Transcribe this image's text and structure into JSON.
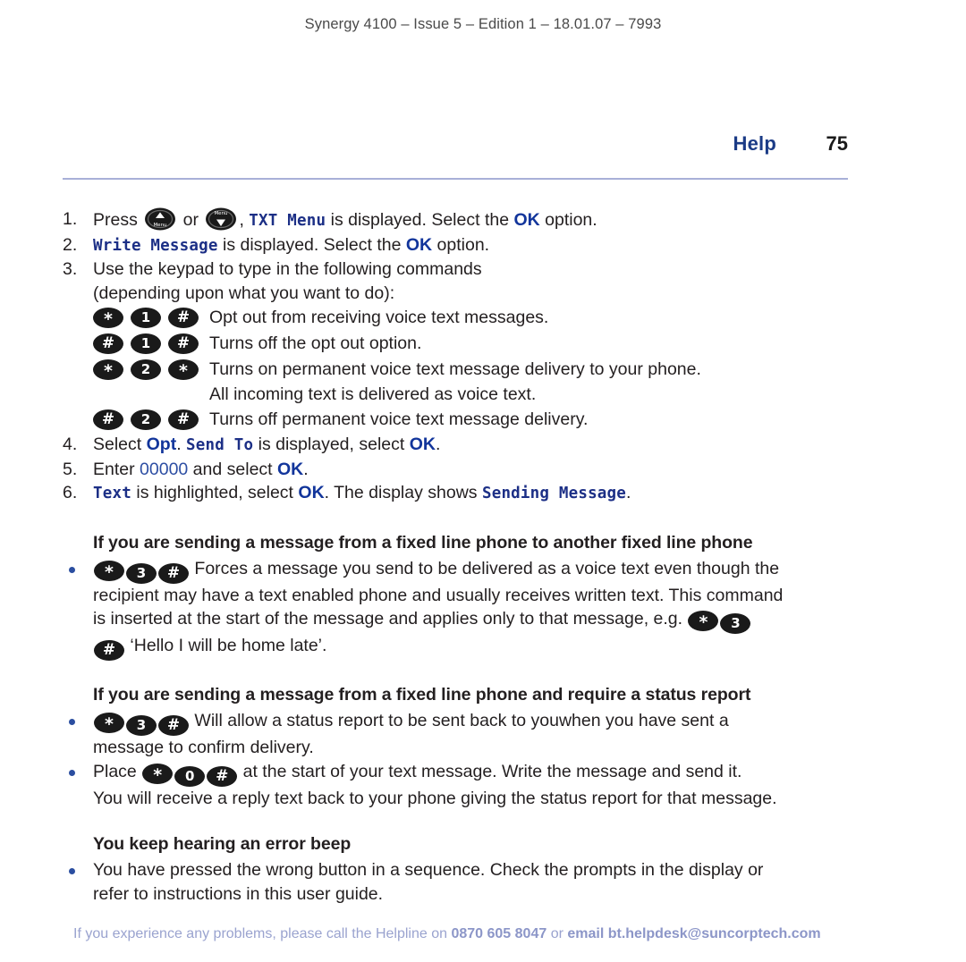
{
  "running_head": "Synergy 4100 – Issue 5 – Edition 1 – 18.01.07 – 7993",
  "header": {
    "section_title": "Help",
    "page_number": "75",
    "title_color": "#1b3b86",
    "rule_color": "#a8b0d8"
  },
  "steps": [
    {
      "number": "1.",
      "parts": [
        {
          "type": "text",
          "value": "Press "
        },
        {
          "type": "menu-up-icon",
          "value": "Menu"
        },
        {
          "type": "text",
          "value": " or "
        },
        {
          "type": "menu-down-icon",
          "value": "Menu"
        },
        {
          "type": "text",
          "value": ", "
        },
        {
          "type": "lcd",
          "value": "TXT Menu"
        },
        {
          "type": "text",
          "value": " is displayed. Select the "
        },
        {
          "type": "ok",
          "value": "OK"
        },
        {
          "type": "text",
          "value": " option."
        }
      ]
    },
    {
      "number": "2.",
      "parts": [
        {
          "type": "lcd",
          "value": "Write Message"
        },
        {
          "type": "text",
          "value": " is displayed. Select the "
        },
        {
          "type": "ok",
          "value": "OK"
        },
        {
          "type": "text",
          "value": " option."
        }
      ]
    },
    {
      "number": "3.",
      "line1": "Use the keypad to type in the following commands",
      "line2": "(depending upon what you want to do):"
    }
  ],
  "commands": [
    {
      "keys": [
        "*",
        "1",
        "#"
      ],
      "description": "Opt out from receiving voice text messages.",
      "continuation": ""
    },
    {
      "keys": [
        "#",
        "1",
        "#"
      ],
      "description": "Turns off the opt out option.",
      "continuation": ""
    },
    {
      "keys": [
        "*",
        "2",
        "*"
      ],
      "description": "Turns on permanent voice text message delivery to your phone.",
      "continuation": "All incoming text is delivered as voice text."
    },
    {
      "keys": [
        "#",
        "2",
        "#"
      ],
      "description": "Turns off permanent voice text message delivery.",
      "continuation": ""
    }
  ],
  "steps_tail": [
    {
      "number": "4.",
      "parts": [
        {
          "type": "text",
          "value": "Select "
        },
        {
          "type": "opt",
          "value": "Opt"
        },
        {
          "type": "text",
          "value": ". "
        },
        {
          "type": "lcd",
          "value": "Send To"
        },
        {
          "type": "text",
          "value": " is displayed, select "
        },
        {
          "type": "ok",
          "value": "OK"
        },
        {
          "type": "text",
          "value": "."
        }
      ]
    },
    {
      "number": "5.",
      "parts": [
        {
          "type": "text",
          "value": "Enter "
        },
        {
          "type": "bluenum",
          "value": "00000"
        },
        {
          "type": "text",
          "value": " and select "
        },
        {
          "type": "ok",
          "value": "OK"
        },
        {
          "type": "text",
          "value": "."
        }
      ]
    },
    {
      "number": "6.",
      "parts": [
        {
          "type": "lcd",
          "value": "Text"
        },
        {
          "type": "text",
          "value": " is highlighted, select "
        },
        {
          "type": "ok",
          "value": "OK"
        },
        {
          "type": "text",
          "value": ". The display shows "
        },
        {
          "type": "lcd",
          "value": "Sending Message"
        },
        {
          "type": "text",
          "value": "."
        }
      ]
    }
  ],
  "section_fixed_line": {
    "heading": "If you are sending a message from a fixed line phone to another fixed line phone",
    "bullet": {
      "lead_keys": [
        "*",
        "3",
        "#"
      ],
      "line1": "Forces a message you send to be delivered as a voice text even though the",
      "line2": "recipient may have a text enabled phone and usually receives written text. This command",
      "line3_pre": "is inserted at the start of the message and applies only to that message, e.g. ",
      "line3_keys": [
        "*",
        "3"
      ],
      "line4_keys": [
        "#"
      ],
      "line4_post": " ‘Hello I will be home late’."
    }
  },
  "section_status_report": {
    "heading": "If you are sending a message from a fixed line phone and require a status report",
    "bullet1": {
      "lead_keys": [
        "*",
        "3",
        "#"
      ],
      "line1": "Will allow a status report to be sent back to youwhen you have sent a",
      "line2": "message to confirm delivery."
    },
    "bullet2": {
      "pre": "Place ",
      "keys": [
        "*",
        "0",
        "#"
      ],
      "post": " at the start of your text message. Write the message and send it.",
      "line2": "You will receive a reply text back to your phone giving the status report for that message."
    }
  },
  "section_error_beep": {
    "heading": "You keep hearing an error beep",
    "bullet": {
      "line1": "You have pressed the wrong button in a sequence. Check the prompts in the display or",
      "line2": "refer to instructions in this user guide."
    }
  },
  "footer": {
    "part1": "If you experience any problems, please call the Helpline on ",
    "phone": "0870 605 8047",
    "part2": " or ",
    "email": "email bt.helpdesk@suncorptech.com",
    "color": "#9aa3cf"
  }
}
